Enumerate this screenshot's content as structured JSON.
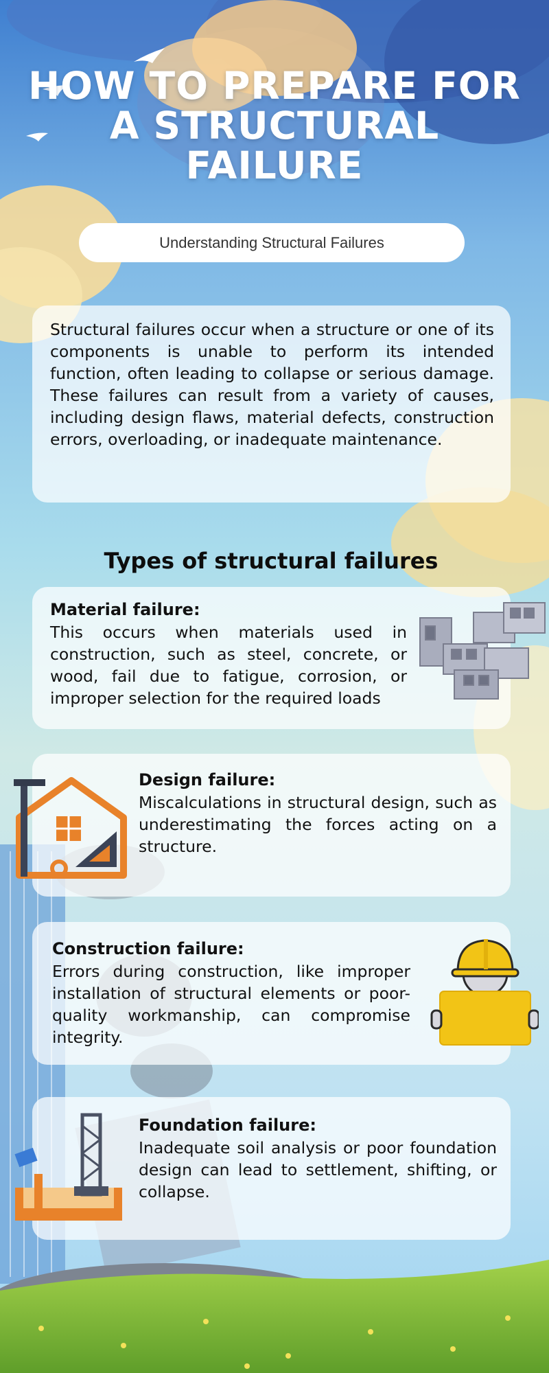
{
  "header": {
    "title": "HOW TO PREPARE FOR A STRUCTURAL FAILURE",
    "subtitle_pill": "Understanding Structural Failures"
  },
  "intro": {
    "text": "Structural failures occur when a structure or one of its components is unable to perform its intended function, often leading to collapse or serious damage. These failures can result from a variety of causes, including design flaws, material defects, construction errors, overloading, or inadequate maintenance."
  },
  "types": {
    "heading": "Types of structural failures",
    "items": [
      {
        "title": "Material failure:",
        "text": "This occurs when materials used in construction, such as steel, concrete, or wood, fail due to fatigue, corrosion, or improper selection for the required loads",
        "icon": "concrete-blocks-icon"
      },
      {
        "title": "Design failure:",
        "text": "Miscalculations in structural design, such as underestimating the forces acting on a structure.",
        "icon": "house-blueprint-icon"
      },
      {
        "title": "Construction failure:",
        "text": "Errors during construction, like improper installation of structural elements or poor-quality workmanship, can compromise integrity.",
        "icon": "construction-worker-icon"
      },
      {
        "title": "Foundation failure:",
        "text": "Inadequate soil analysis or poor foundation design can lead to settlement, shifting, or collapse.",
        "icon": "foundation-drill-icon"
      }
    ]
  },
  "colors": {
    "sky_top": "#4a8fd8",
    "sky_mid": "#8cc8ea",
    "grass": "#8cc63f",
    "accent_orange": "#e8822a",
    "hardhat_yellow": "#f2c416"
  }
}
